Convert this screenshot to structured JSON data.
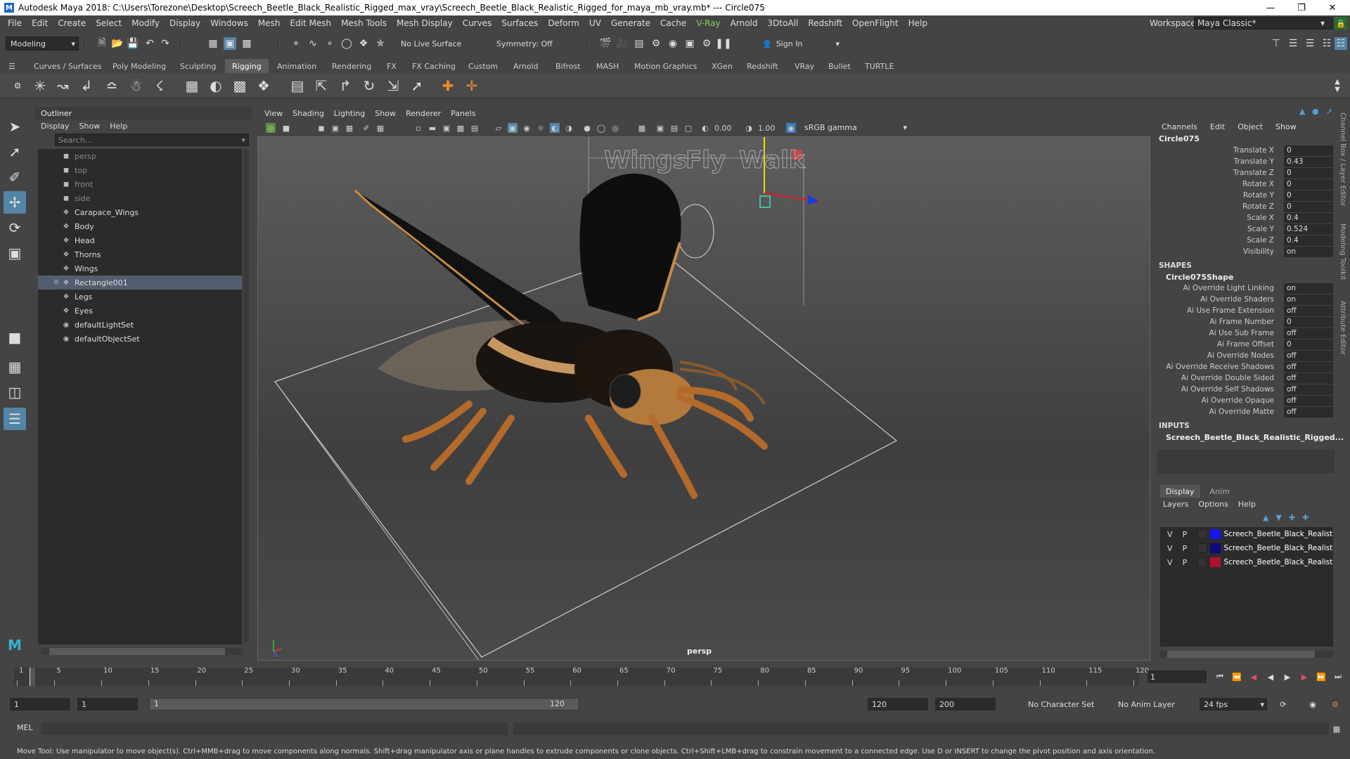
{
  "window": {
    "title": "Autodesk Maya 2018: C:\\Users\\Torezone\\Desktop\\Screech_Beetle_Black_Realistic_Rigged_max_vray\\Screech_Beetle_Black_Realistic_Rigged_for_maya_mb_vray.mb*   ---   Circle075",
    "app_icon": "M"
  },
  "menubar": {
    "items": [
      "File",
      "Edit",
      "Create",
      "Select",
      "Modify",
      "Display",
      "Windows",
      "Mesh",
      "Edit Mesh",
      "Mesh Tools",
      "Mesh Display",
      "Curves",
      "Surfaces",
      "Deform",
      "UV",
      "Generate",
      "Cache",
      "V-Ray",
      "Arnold",
      "3DtoAll",
      "Redshift",
      "OpenFlight",
      "Help"
    ],
    "workspace_label": "Workspace :",
    "workspace_value": "Maya Classic*"
  },
  "statusline": {
    "mode": "Modeling",
    "live_surface": "No Live Surface",
    "symmetry": "Symmetry: Off",
    "sign_in": "Sign In"
  },
  "shelf": {
    "tabs": [
      "Curves / Surfaces",
      "Poly Modeling",
      "Sculpting",
      "Rigging",
      "Animation",
      "Rendering",
      "FX",
      "FX Caching",
      "Custom",
      "Arnold",
      "Bifrost",
      "MASH",
      "Motion Graphics",
      "XGen",
      "Redshift",
      "VRay",
      "Bullet",
      "TURTLE"
    ],
    "active_tab": "Rigging"
  },
  "outliner": {
    "title": "Outliner",
    "menu": [
      "Display",
      "Show",
      "Help"
    ],
    "search_placeholder": "Search...",
    "items": [
      {
        "label": "persp",
        "type": "camera"
      },
      {
        "label": "top",
        "type": "camera"
      },
      {
        "label": "front",
        "type": "camera"
      },
      {
        "label": "side",
        "type": "camera"
      },
      {
        "label": "Carapace_Wings",
        "type": "group"
      },
      {
        "label": "Body",
        "type": "group"
      },
      {
        "label": "Head",
        "type": "group"
      },
      {
        "label": "Thorns",
        "type": "group"
      },
      {
        "label": "Wings",
        "type": "group"
      },
      {
        "label": "Rectangle001",
        "type": "group",
        "selected": true,
        "expandable": true
      },
      {
        "label": "Legs",
        "type": "group"
      },
      {
        "label": "Eyes",
        "type": "group"
      },
      {
        "label": "defaultLightSet",
        "type": "set"
      },
      {
        "label": "defaultObjectSet",
        "type": "set"
      }
    ]
  },
  "viewport": {
    "menu": [
      "View",
      "Shading",
      "Lighting",
      "Show",
      "Renderer",
      "Panels"
    ],
    "exposure": "0.00",
    "gamma": "1.00",
    "color_space": "sRGB gamma",
    "camera_label": "persp",
    "scene_text": [
      "Wings",
      "Fly",
      "Walk"
    ]
  },
  "channelbox": {
    "menu": [
      "Channels",
      "Edit",
      "Object",
      "Show"
    ],
    "object": "Circle075",
    "attributes": [
      {
        "name": "Translate X",
        "value": "0"
      },
      {
        "name": "Translate Y",
        "value": "0.43"
      },
      {
        "name": "Translate Z",
        "value": "0"
      },
      {
        "name": "Rotate X",
        "value": "0"
      },
      {
        "name": "Rotate Y",
        "value": "0"
      },
      {
        "name": "Rotate Z",
        "value": "0"
      },
      {
        "name": "Scale X",
        "value": "0.4"
      },
      {
        "name": "Scale Y",
        "value": "0.524"
      },
      {
        "name": "Scale Z",
        "value": "0.4"
      },
      {
        "name": "Visibility",
        "value": "on"
      }
    ],
    "shapes_label": "SHAPES",
    "shape_name": "Circle075Shape",
    "shape_attributes": [
      {
        "name": "Ai Override Light Linking",
        "value": "on"
      },
      {
        "name": "Ai Override Shaders",
        "value": "on"
      },
      {
        "name": "Ai Use Frame Extension",
        "value": "off"
      },
      {
        "name": "Ai Frame Number",
        "value": "0"
      },
      {
        "name": "Ai Use Sub Frame",
        "value": "off"
      },
      {
        "name": "Ai Frame Offset",
        "value": "0"
      },
      {
        "name": "Ai Override Nodes",
        "value": "off"
      },
      {
        "name": "Ai Override Receive Shadows",
        "value": "off"
      },
      {
        "name": "Ai Override Double Sided",
        "value": "off"
      },
      {
        "name": "Ai Override Self Shadows",
        "value": "off"
      },
      {
        "name": "Ai Override Opaque",
        "value": "off"
      },
      {
        "name": "Ai Override Matte",
        "value": "off"
      }
    ],
    "inputs_label": "INPUTS",
    "input_name": "Screech_Beetle_Black_Realistic_Rigged..."
  },
  "side_tabs": [
    "Channel Box / Layer Editor",
    "Modeling Toolkit",
    "Attribute Editor"
  ],
  "layers": {
    "tabs": [
      "Display",
      "Anim"
    ],
    "active_tab": "Display",
    "menu": [
      "Layers",
      "Options",
      "Help"
    ],
    "rows": [
      {
        "v": "V",
        "p": "P",
        "color": "#1515f0",
        "name": "Screech_Beetle_Black_Realistic"
      },
      {
        "v": "V",
        "p": "P",
        "color": "#0c0c78",
        "name": "Screech_Beetle_Black_Realistic"
      },
      {
        "v": "V",
        "p": "P",
        "color": "#b01030",
        "name": "Screech_Beetle_Black_Realistic"
      }
    ]
  },
  "timeline": {
    "ticks": [
      "1",
      "5",
      "10",
      "15",
      "20",
      "25",
      "30",
      "35",
      "40",
      "45",
      "50",
      "55",
      "60",
      "65",
      "70",
      "75",
      "80",
      "85",
      "90",
      "95",
      "100",
      "105",
      "110",
      "115",
      "120"
    ],
    "current_frame": "1"
  },
  "range": {
    "start": "1",
    "anim_start": "1",
    "range_start": "1",
    "range_end": "120",
    "anim_end": "120",
    "end": "200",
    "character_set": "No Character Set",
    "anim_layer": "No Anim Layer",
    "fps": "24 fps"
  },
  "cmdline": {
    "label": "MEL"
  },
  "helpline": {
    "text": "Move Tool: Use manipulator to move object(s). Ctrl+MMB+drag to move components along normals. Shift+drag manipulator axis or plane handles to extrude components or clone objects. Ctrl+Shift+LMB+drag to constrain movement to a connected edge. Use D or INSERT to change the pivot position and axis orientation."
  }
}
